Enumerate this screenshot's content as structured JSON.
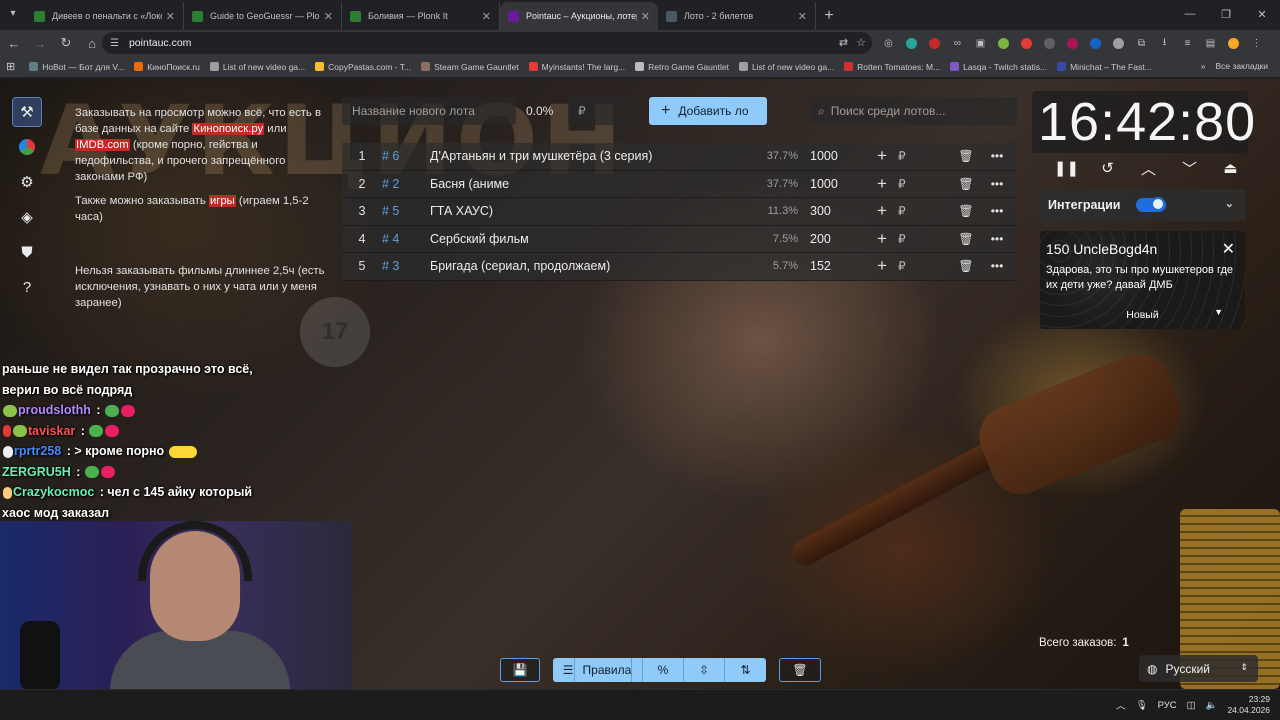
{
  "browser": {
    "tabs": [
      {
        "title": "Дивеев о пенальти с «Локо»: ...",
        "color": "#2e7d32",
        "active": false
      },
      {
        "title": "Guide to GeoGuessr — Plonk It",
        "color": "#2e7d32",
        "active": false
      },
      {
        "title": "Боливия — Plonk It",
        "color": "#2e7d32",
        "active": false
      },
      {
        "title": "Pointauc – Аукционы, лотереи",
        "color": "#6a1b9a",
        "active": true
      },
      {
        "title": "Лото - 2 билетов",
        "color": "#455a64",
        "active": false
      }
    ],
    "url": "pointauc.com",
    "bookmarks": [
      {
        "label": "HoBot — Бот для V...",
        "color": "#607d8b"
      },
      {
        "label": "КиноПоиск.ru",
        "color": "#ef6c00"
      },
      {
        "label": "List of new video ga...",
        "color": "#9e9e9e"
      },
      {
        "label": "CopyPastas.com - T...",
        "color": "#fbc02d"
      },
      {
        "label": "Steam Game Gauntlet",
        "color": "#8d6e63"
      },
      {
        "label": "Myinstants! The larg...",
        "color": "#e53935"
      },
      {
        "label": "Retro Game Gauntlet",
        "color": "#bdbdbd"
      },
      {
        "label": "List of new video ga...",
        "color": "#9e9e9e"
      },
      {
        "label": "Rotten Tomatoes: M...",
        "color": "#d32f2f"
      },
      {
        "label": "Lasqa - Twitch statis...",
        "color": "#7e57c2"
      },
      {
        "label": "Minichat – The Fast...",
        "color": "#3949ab"
      }
    ],
    "all_bookmarks": "Все закладки"
  },
  "rules": {
    "p1_pre": "Заказывать на просмотр можно всё, что есть в базе данных на сайте ",
    "p1_link1": "Кинопоиск.ру",
    "p1_mid": " или ",
    "p1_link2": "IMDB.com",
    "p1_post": " (кроме порно, гейства и педофильства, и прочего запрещённого законами РФ)",
    "p2_pre": "Также можно заказывать ",
    "p2_link": "игры",
    "p2_post": " (играем 1,5-2 часа)",
    "p3": "Нельзя заказывать фильмы длиннее 2,5ч (есть исключения, узнавать о них у чата или у меня заранее)"
  },
  "new_lot": {
    "name_placeholder": "Название нового лота",
    "percent": "0.0%",
    "currency": "₽",
    "add_label": "Добавить ло"
  },
  "search": {
    "placeholder": "Поиск среди лотов..."
  },
  "lots": [
    {
      "pos": "1",
      "id": "# 6",
      "name": "Д'Артаньян и три мушкетёра (3 серия)",
      "pct": "37.7%",
      "amount": "1000"
    },
    {
      "pos": "2",
      "id": "# 2",
      "name": "Басня (аниме",
      "pct": "37.7%",
      "amount": "1000"
    },
    {
      "pos": "3",
      "id": "# 5",
      "name": "ГТА ХАУС)",
      "pct": "11.3%",
      "amount": "300"
    },
    {
      "pos": "4",
      "id": "# 4",
      "name": "Сербский фильм",
      "pct": "7.5%",
      "amount": "200"
    },
    {
      "pos": "5",
      "id": "# 3",
      "name": "Бригада (сериал, продолжаем)",
      "pct": "5.7%",
      "amount": "152"
    }
  ],
  "lot_currency": "₽",
  "timer": "16:42:80",
  "integrations": {
    "label": "Интеграции",
    "enabled": true
  },
  "donation": {
    "header": "150 UncleBogd4n",
    "message": "Здарова, это ты про мушкетеров где их дети уже? давай ДМБ",
    "status": "Новый"
  },
  "total_orders": {
    "label": "Всего заказов:",
    "count": "1"
  },
  "language": "Русский",
  "bottom_bar": {
    "rules_label": "Правила"
  },
  "chat": {
    "line1": "раньше не видел так прозрачно это всё, верил во всё подряд",
    "msg2_nick": "proudslothh",
    "msg3_nick": "taviskar",
    "msg4_nick": "rprtr258",
    "msg4_text": "> кроме порно",
    "msg5_nick": "ZERGRU5H",
    "msg6_nick": "Crazykocmoc",
    "msg6_text": "чел с 145 айку который хаос мод заказал",
    "colors": {
      "proudslothh": "#b388ff",
      "taviskar": "#ff5252",
      "rprtr258": "#448aff",
      "ZERGRU5H": "#69f0ae",
      "Crazykocmoc": "#69f0ae"
    }
  },
  "background_text": "АУКЦИОН",
  "ball_number": "17",
  "taskbar": {
    "lang": "РУС",
    "time": "23:29",
    "date": "24.04.2026"
  }
}
